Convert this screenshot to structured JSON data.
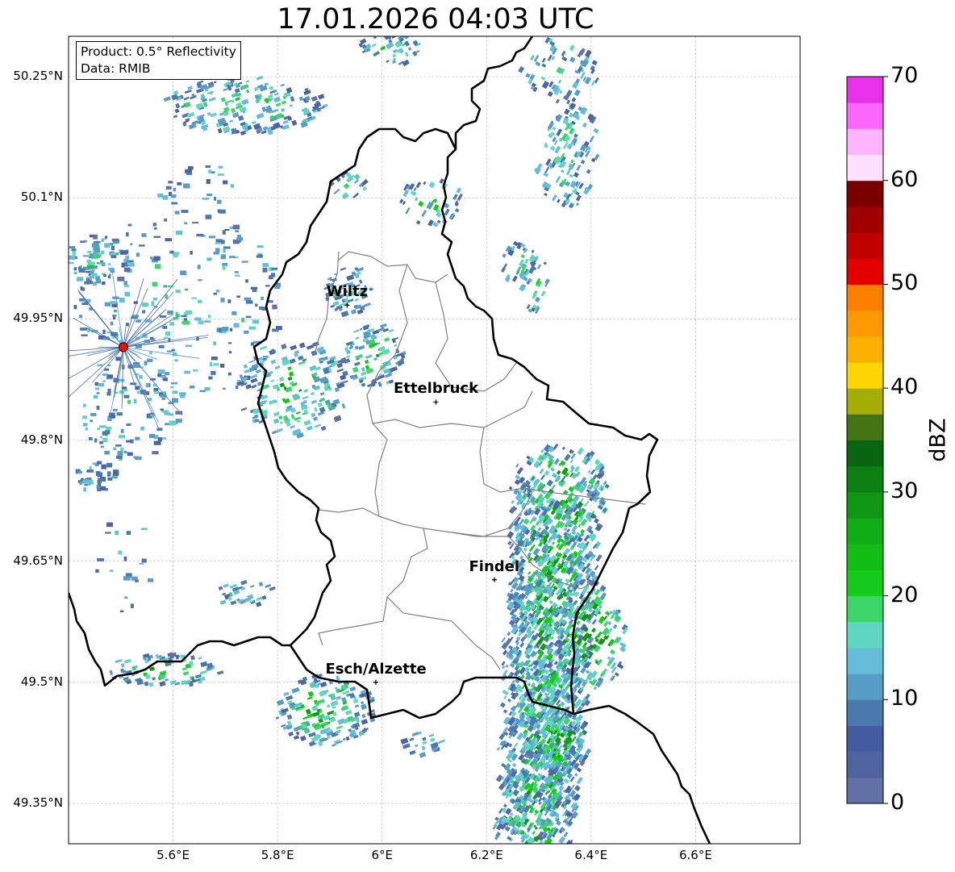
{
  "title": "17.01.2026 04:03 UTC",
  "info_box": {
    "product": "Product: 0.5° Reflectivity",
    "data": "Data: RMIB"
  },
  "map": {
    "lon_range": [
      5.4,
      6.8
    ],
    "lat_range": [
      49.3,
      50.3
    ],
    "lon_ticks": [
      {
        "value": 5.6,
        "label": "5.6°E"
      },
      {
        "value": 5.8,
        "label": "5.8°E"
      },
      {
        "value": 6.0,
        "label": "6°E"
      },
      {
        "value": 6.2,
        "label": "6.2°E"
      },
      {
        "value": 6.4,
        "label": "6.4°E"
      },
      {
        "value": 6.6,
        "label": "6.6°E"
      }
    ],
    "lat_ticks": [
      {
        "value": 50.25,
        "label": "50.25°N"
      },
      {
        "value": 50.1,
        "label": "50.1°N"
      },
      {
        "value": 49.95,
        "label": "49.95°N"
      },
      {
        "value": 49.8,
        "label": "49.8°N"
      },
      {
        "value": 49.65,
        "label": "49.65°N"
      },
      {
        "value": 49.5,
        "label": "49.5°N"
      },
      {
        "value": 49.35,
        "label": "49.35°N"
      }
    ],
    "grid": true,
    "radar_site": {
      "lon": 5.505,
      "lat": 49.915,
      "color": "#e8120c"
    },
    "cities": [
      {
        "name": "Wiltz",
        "lon": 5.933,
        "lat": 49.967
      },
      {
        "name": "Ettelbruck",
        "lon": 6.103,
        "lat": 49.847
      },
      {
        "name": "Findel",
        "lon": 6.215,
        "lat": 49.627
      },
      {
        "name": "Esch/Alzette",
        "lon": 5.988,
        "lat": 49.5
      }
    ]
  },
  "colorbar": {
    "label": "dBZ",
    "min": 0,
    "max": 70,
    "ticks": [
      "0",
      "10",
      "20",
      "30",
      "40",
      "50",
      "60",
      "70"
    ],
    "colors": [
      "#6171a6",
      "#4f62a1",
      "#425c9f",
      "#4a79b0",
      "#569cc6",
      "#64bcd9",
      "#5fd6c0",
      "#3bd56b",
      "#14cb19",
      "#12be16",
      "#10ad14",
      "#0e9713",
      "#0c8012",
      "#0a6510",
      "#437413",
      "#a6ad05",
      "#fdd500",
      "#fcb000",
      "#fc9900",
      "#fd7f00",
      "#e50000",
      "#c20000",
      "#a00000",
      "#7a0000",
      "#fde0fd",
      "#fdb3fd",
      "#fd66fd",
      "#e831e8"
    ]
  }
}
